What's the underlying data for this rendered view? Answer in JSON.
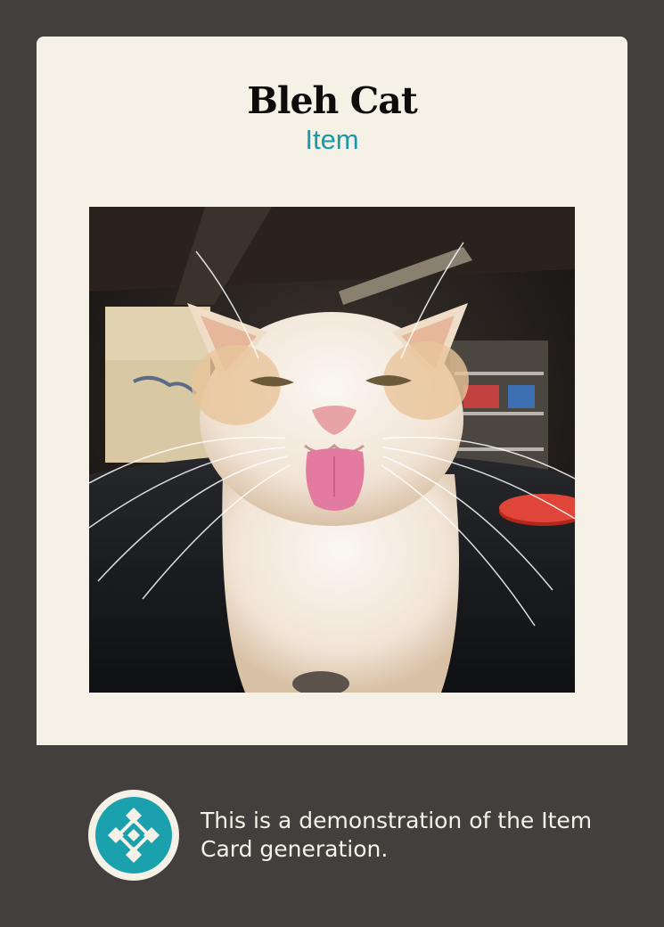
{
  "card": {
    "title": "Bleh Cat",
    "type": "Item",
    "image": "cat-with-tongue-out-photo"
  },
  "footer": {
    "description": "This is a demonstration of the Item Card generation.",
    "icon": "crystal-emblem-icon"
  },
  "colors": {
    "background": "#433f3c",
    "card": "#f5f1e6",
    "accent": "#1aa1ad",
    "title": "#0d0c0b"
  }
}
